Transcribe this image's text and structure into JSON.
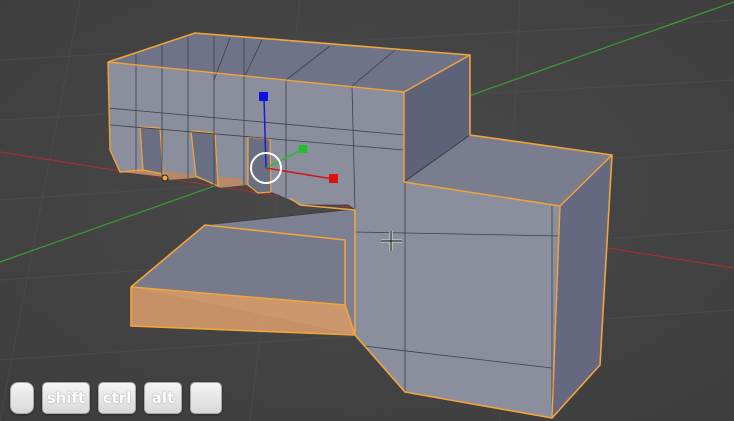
{
  "viewport": {
    "background": "#454545",
    "axis_colors": {
      "x": "#b42c2c",
      "y": "#3c9a3c",
      "z": "#2a2ab4"
    },
    "selection_color": "#f2a53a",
    "mesh_face_color": "#8a8d9a"
  },
  "gizmo": {
    "x_handle_color": "#e01010",
    "y_handle_color": "#20c020",
    "z_handle_color": "#1010e0"
  },
  "cursor_icon": "crosshair-cursor-icon",
  "key_overlay": {
    "mouse_icon": "mouse-icon",
    "shift_label": "shift",
    "ctrl_label": "ctrl",
    "alt_label": "alt",
    "extra_key_label": ""
  }
}
